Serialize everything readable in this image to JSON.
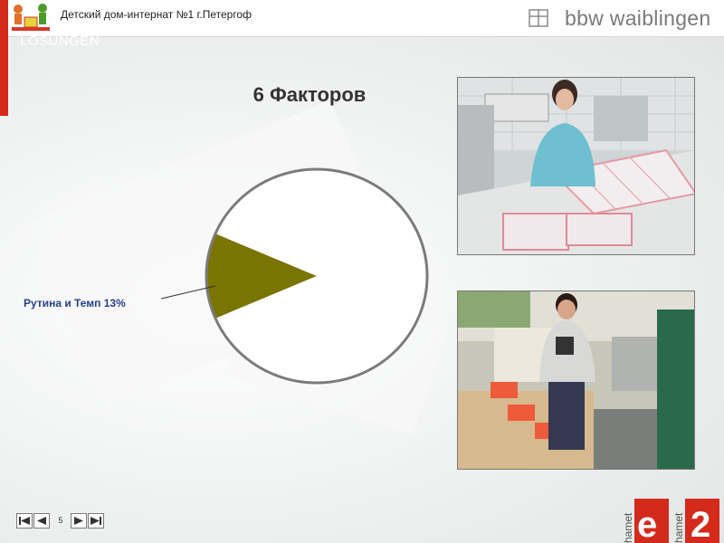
{
  "header": {
    "title": "Детский дом-интернат №1 г.Петергоф",
    "brand": "bbw waiblingen",
    "watermark": "LÖSUNGEN"
  },
  "slide": {
    "title": "6 Факторов"
  },
  "chart_data": {
    "type": "pie",
    "title": "",
    "slices": [
      {
        "label": "Рутина и Темп 13%",
        "value": 13,
        "color": "#7a7400"
      },
      {
        "label": "",
        "value": 87,
        "color": "#ffffff"
      }
    ],
    "labeled_slice": "Рутина и Темп 13%"
  },
  "footer": {
    "page_number": "5",
    "logo_text_left": "hamet",
    "logo_text_right": "hamet",
    "logo_letter": "e",
    "logo_digit": "2"
  },
  "colors": {
    "accent_red": "#d42a1c",
    "label_blue": "#2a3f8f"
  },
  "icons": {
    "first": "first-page-icon",
    "prev": "previous-page-icon",
    "next": "next-page-icon",
    "last": "last-page-icon"
  }
}
